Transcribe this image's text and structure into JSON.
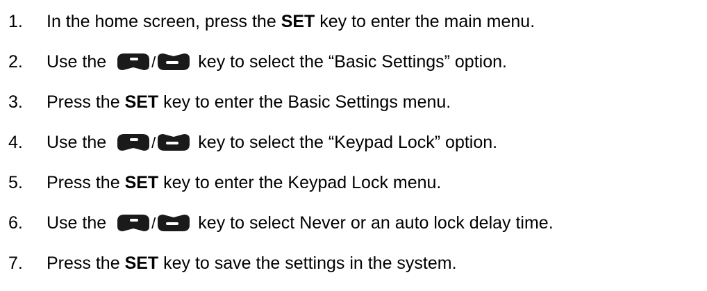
{
  "steps": [
    {
      "num": "1.",
      "pre": "In the home screen, press the ",
      "bold": "SET",
      "post": " key to enter the main menu."
    },
    {
      "num": "2.",
      "pre": "Use the",
      "slash": "/",
      "post": "key to select the “Basic Settings” option."
    },
    {
      "num": "3.",
      "pre": "Press the ",
      "bold": "SET",
      "post": " key to enter the Basic Settings menu."
    },
    {
      "num": "4.",
      "pre": "Use the",
      "slash": "/",
      "post": "key to select the “Keypad Lock” option."
    },
    {
      "num": "5.",
      "pre": "Press the ",
      "bold": "SET",
      "post": " key to enter the Keypad Lock menu."
    },
    {
      "num": "6.",
      "pre": "Use the",
      "slash": "/",
      "post": "key to select Never or an auto lock delay time."
    },
    {
      "num": "7.",
      "pre": "Press the ",
      "bold": "SET",
      "post": " key to save the settings in the system."
    }
  ],
  "icons": {
    "up": "up-key-icon",
    "down": "down-key-icon"
  },
  "colors": {
    "key_fill": "#1a1a1a",
    "key_symbol": "#ffffff"
  }
}
